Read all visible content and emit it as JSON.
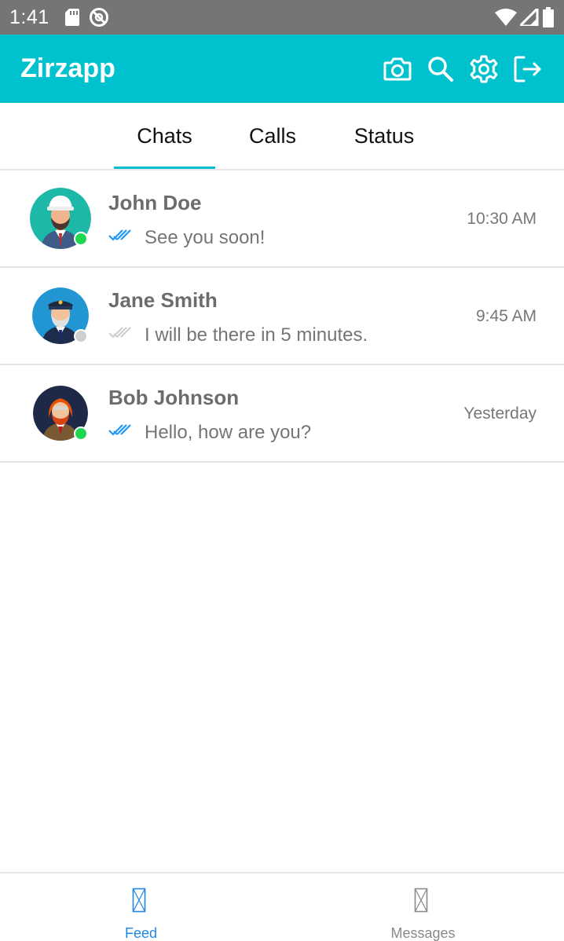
{
  "status_bar": {
    "time": "1:41"
  },
  "app_bar": {
    "title": "Zirzapp",
    "actions": [
      "camera-icon",
      "search-icon",
      "gear-icon",
      "logout-icon"
    ]
  },
  "tabs": [
    {
      "label": "Chats",
      "active": true
    },
    {
      "label": "Calls",
      "active": false
    },
    {
      "label": "Status",
      "active": false
    }
  ],
  "colors": {
    "app_bar": "#00c2ce",
    "tab_indicator": "#00bcd4",
    "online": "#1ed94f",
    "offline": "#cfcfcf",
    "read_ticks": "#2196f3",
    "nav_active": "#1e88e5"
  },
  "chats": [
    {
      "name": "John Doe",
      "message": "See you soon!",
      "time": "10:30 AM",
      "online": true,
      "read": true,
      "avatar": "builder-avatar"
    },
    {
      "name": "Jane Smith",
      "message": "I will be there in 5 minutes.",
      "time": "9:45 AM",
      "online": false,
      "read": false,
      "avatar": "pilot-avatar"
    },
    {
      "name": "Bob Johnson",
      "message": "Hello, how are you?",
      "time": "Yesterday",
      "online": true,
      "read": true,
      "avatar": "redhair-avatar"
    }
  ],
  "bottom_nav": [
    {
      "label": "Feed",
      "active": true
    },
    {
      "label": "Messages",
      "active": false
    }
  ]
}
